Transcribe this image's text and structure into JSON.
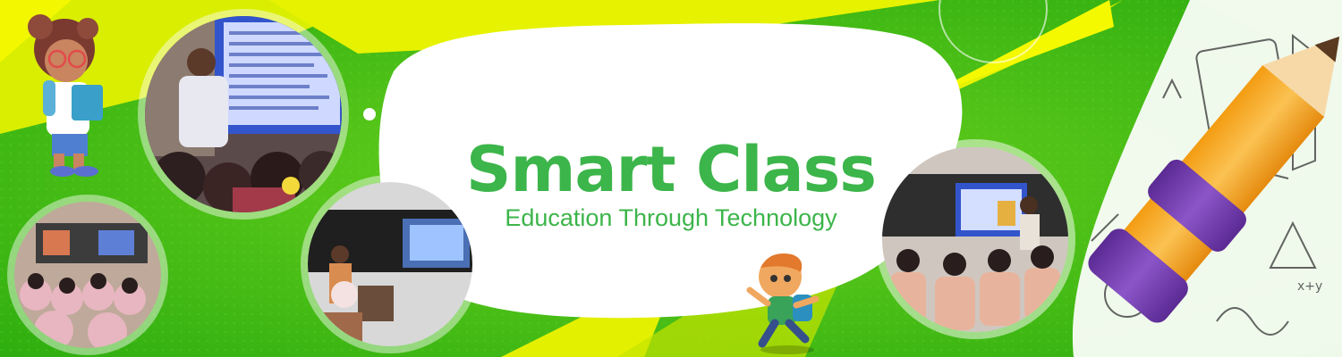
{
  "banner": {
    "title": "Smart Class",
    "subtitle": "Education Through Technology"
  },
  "photos": [
    {
      "name": "classroom-photo-teacher-speaking",
      "icon": "classroom-photo"
    },
    {
      "name": "classroom-photo-students-standing",
      "icon": "classroom-photo"
    },
    {
      "name": "classroom-photo-projector-screen",
      "icon": "classroom-photo"
    },
    {
      "name": "classroom-photo-students-seated",
      "icon": "classroom-photo"
    }
  ],
  "illustrations": [
    "girl-with-books-illustration",
    "running-boy-illustration",
    "pencil-illustration",
    "school-doodles-illustration"
  ],
  "colors": {
    "brand_green": "#3cb54a",
    "bright_green": "#4fc21c",
    "lime": "#e6f000",
    "white": "#ffffff",
    "pencil_orange": "#f6a623",
    "pencil_purple": "#7a3fb0"
  }
}
